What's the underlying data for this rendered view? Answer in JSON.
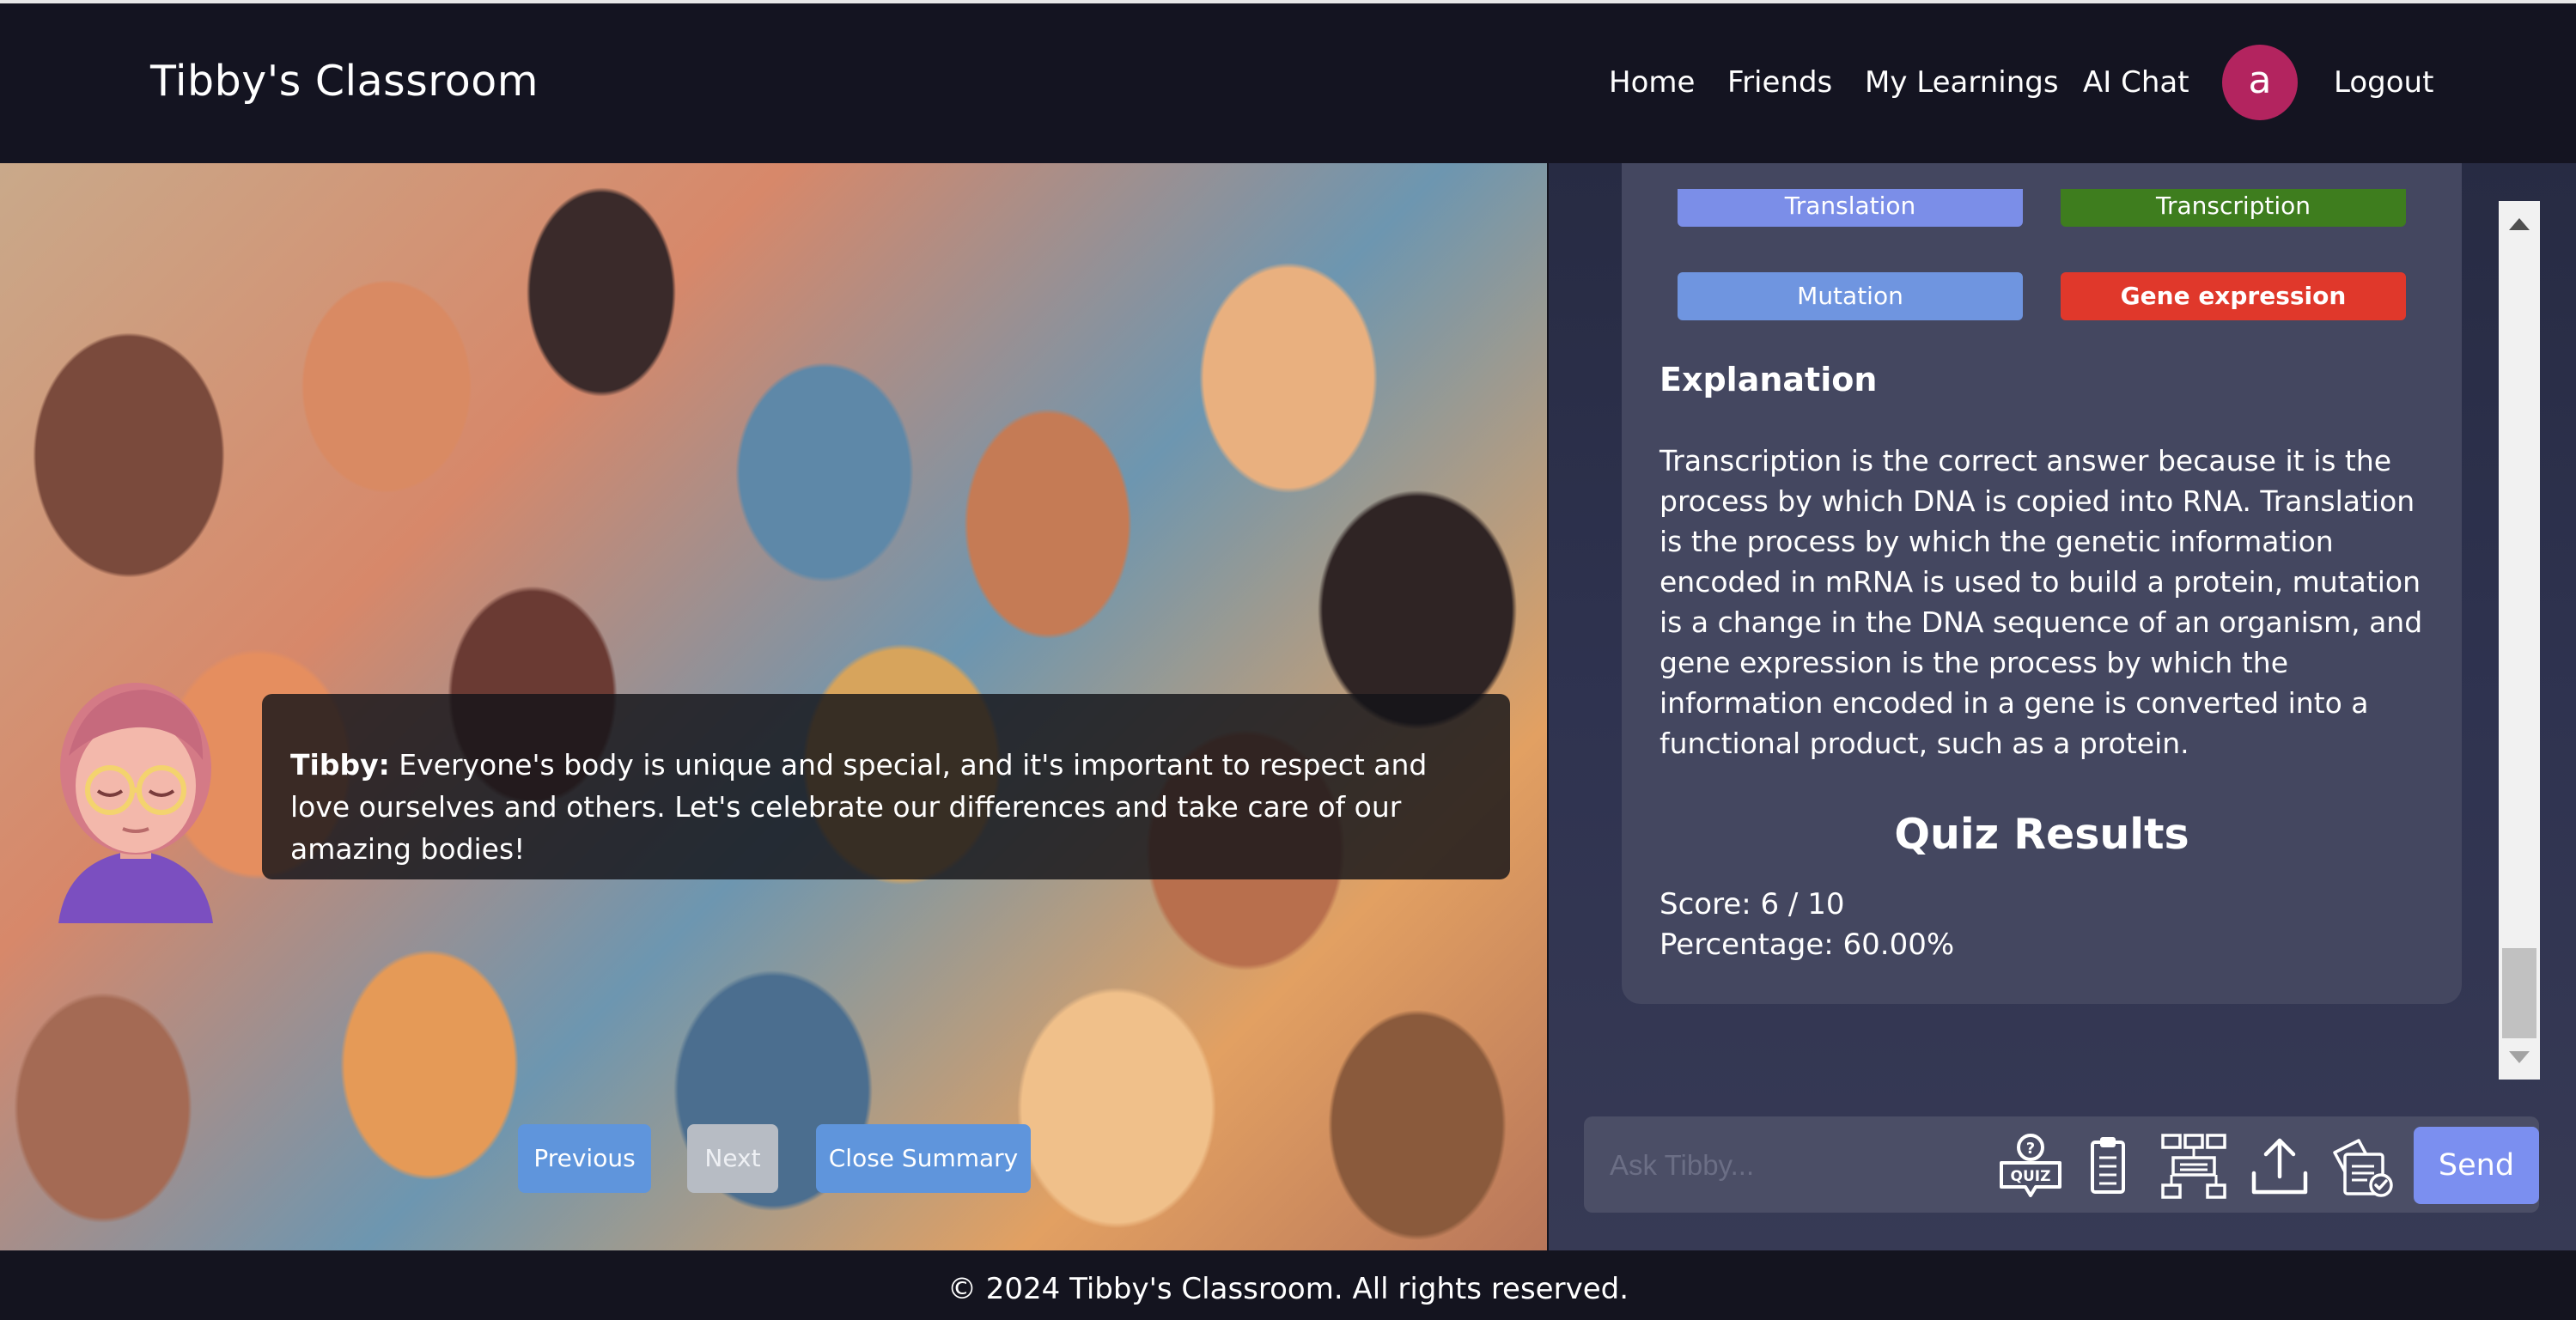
{
  "header": {
    "brand": "Tibby's Classroom",
    "nav": [
      "Home",
      "Friends",
      "My Learnings",
      "AI Chat"
    ],
    "avatar_initial": "a",
    "logout": "Logout"
  },
  "scene": {
    "speaker": "Tibby:",
    "message": "Everyone's body is unique and special, and it's important to respect and love ourselves and others. Let's celebrate our differences and take care of our amazing bodies!",
    "buttons": {
      "previous": "Previous",
      "next": "Next",
      "close": "Close Summary"
    }
  },
  "quiz": {
    "options": [
      {
        "label": "Translation",
        "color": "#7b8ee8"
      },
      {
        "label": "Transcription",
        "color": "#3e7d1e"
      },
      {
        "label": "Mutation",
        "color": "#6f95e0"
      },
      {
        "label": "Gene expression",
        "color": "#e0382b"
      }
    ],
    "explanation_title": "Explanation",
    "explanation_text": "Transcription is the correct answer because it is the process by which DNA is copied into RNA. Translation is the process by which the genetic information encoded in mRNA is used to build a protein, mutation is a change in the DNA sequence of an organism, and gene expression is the process by which the information encoded in a gene is converted into a functional product, such as a protein.",
    "results_title": "Quiz Results",
    "score": "Score: 6 / 10",
    "percentage": "Percentage: 60.00%"
  },
  "chat": {
    "placeholder": "Ask Tibby...",
    "send": "Send",
    "tools": [
      "quiz-icon",
      "clipboard-icon",
      "flowchart-icon",
      "upload-icon",
      "documents-check-icon"
    ],
    "quiz_icon_text": "QUIZ"
  },
  "footer": {
    "text": "© 2024 Tibby's Classroom. All rights reserved."
  }
}
